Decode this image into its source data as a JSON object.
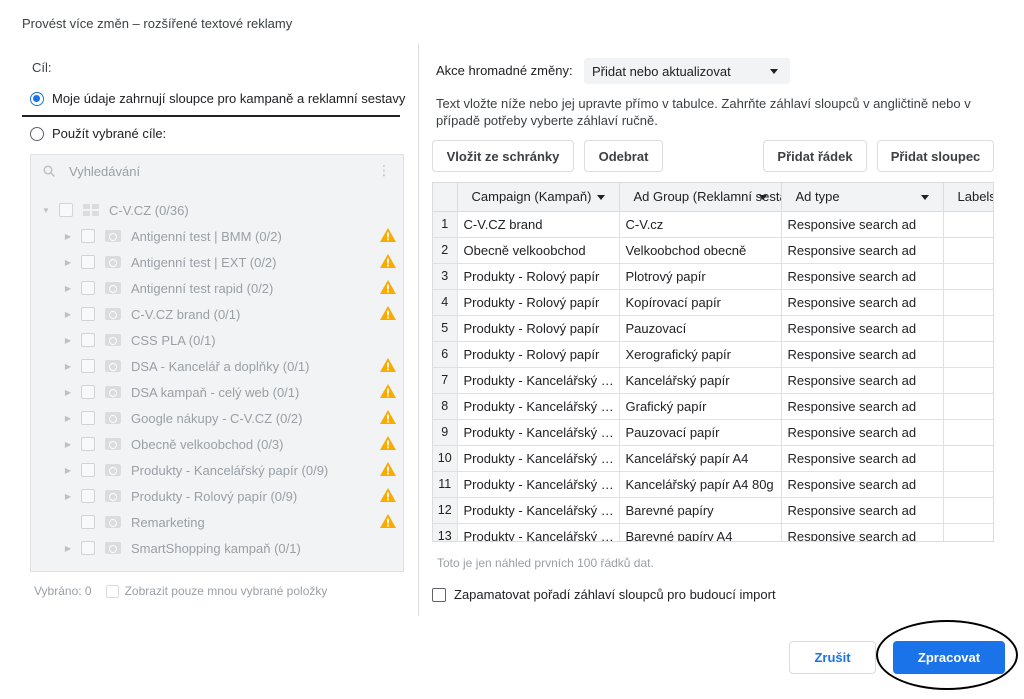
{
  "dialog": {
    "title": "Provést více změn – rozšířené textové reklamy"
  },
  "left": {
    "target_label": "Cíl:",
    "radio_option1": "Moje údaje zahrnují sloupce pro kampaně a reklamní sestavy",
    "radio_option2": "Použít vybrané cíle:",
    "search_placeholder": "Vyhledávání",
    "tree": {
      "root": "C-V.CZ (0/36)",
      "items": [
        {
          "label": "Antigenní test | BMM (0/2)",
          "icon": "search-campaign-icon",
          "warning": true,
          "expandable": true
        },
        {
          "label": "Antigenní test | EXT (0/2)",
          "icon": "search-campaign-icon",
          "warning": true,
          "expandable": true
        },
        {
          "label": "Antigenní test rapid (0/2)",
          "icon": "search-campaign-icon",
          "warning": true,
          "expandable": true
        },
        {
          "label": "C-V.CZ brand (0/1)",
          "icon": "search-campaign-icon",
          "warning": true,
          "expandable": true
        },
        {
          "label": "CSS PLA (0/1)",
          "icon": "shopping-tag-icon",
          "warning": false,
          "expandable": true
        },
        {
          "label": "DSA - Kancelář a doplňky (0/1)",
          "icon": "search-campaign-icon",
          "warning": true,
          "expandable": true
        },
        {
          "label": "DSA kampaň - celý web (0/1)",
          "icon": "search-campaign-icon",
          "warning": true,
          "expandable": true
        },
        {
          "label": "Google nákupy - C-V.CZ (0/2)",
          "icon": "shopping-tag-icon",
          "warning": true,
          "expandable": true
        },
        {
          "label": "Obecně velkoobchod (0/3)",
          "icon": "search-campaign-icon",
          "warning": true,
          "expandable": true
        },
        {
          "label": "Produkty - Kancelářský papír (0/9)",
          "icon": "search-campaign-icon",
          "warning": true,
          "expandable": true
        },
        {
          "label": "Produkty - Rolový papír (0/9)",
          "icon": "search-campaign-icon",
          "warning": true,
          "expandable": true
        },
        {
          "label": "Remarketing",
          "icon": "display-campaign-icon",
          "warning": true,
          "expandable": false
        },
        {
          "label": "SmartShopping kampaň (0/1)",
          "icon": "shopping-tag-icon",
          "warning": false,
          "expandable": true
        }
      ]
    },
    "selected_count": "Vybráno: 0",
    "show_only_selected": "Zobrazit pouze mnou vybrané položky"
  },
  "right": {
    "bulk_action_label": "Akce hromadné změny:",
    "bulk_action_value": "Přidat nebo aktualizovat",
    "help_text": "Text vložte níže nebo jej upravte přímo v tabulce. Zahrňte záhlaví sloupců v angličtině nebo v případě potřeby vyberte záhlaví ručně.",
    "buttons": {
      "paste": "Vložit ze schránky",
      "remove": "Odebrat",
      "add_row": "Přidat řádek",
      "add_column": "Přidat sloupec"
    },
    "table": {
      "headers": [
        "Campaign (Kampaň)",
        "Ad Group (Reklamní sestava)",
        "Ad type",
        "Labels"
      ],
      "rows": [
        [
          "1",
          "C-V.CZ brand",
          "C-V.cz",
          "Responsive search ad"
        ],
        [
          "2",
          "Obecně velkoobchod",
          "Velkoobchod obecně",
          "Responsive search ad"
        ],
        [
          "3",
          "Produkty - Rolový papír",
          "Plotrový papír",
          "Responsive search ad"
        ],
        [
          "4",
          "Produkty - Rolový papír",
          "Kopírovací papír",
          "Responsive search ad"
        ],
        [
          "5",
          "Produkty - Rolový papír",
          "Pauzovací",
          "Responsive search ad"
        ],
        [
          "6",
          "Produkty - Rolový papír",
          "Xerografický papír",
          "Responsive search ad"
        ],
        [
          "7",
          "Produkty - Kancelářský papír",
          "Kancelářský papír",
          "Responsive search ad"
        ],
        [
          "8",
          "Produkty - Kancelářský papír",
          "Grafický papír",
          "Responsive search ad"
        ],
        [
          "9",
          "Produkty - Kancelářský papír",
          "Pauzovací papír",
          "Responsive search ad"
        ],
        [
          "10",
          "Produkty - Kancelářský papír",
          "Kancelářský papír A4",
          "Responsive search ad"
        ],
        [
          "11",
          "Produkty - Kancelářský papír",
          "Kancelářský papír A4 80g",
          "Responsive search ad"
        ],
        [
          "12",
          "Produkty - Kancelářský papír",
          "Barevné papíry",
          "Responsive search ad"
        ],
        [
          "13",
          "Produkty - Kancelářský papír",
          "Barevné papíry A4",
          "Responsive search ad"
        ]
      ]
    },
    "preview_note": "Toto je jen náhled prvních 100 řádků dat.",
    "remember_headers": "Zapamatovat pořadí záhlaví sloupců pro budoucí import"
  },
  "footer": {
    "cancel": "Zrušit",
    "process": "Zpracovat"
  },
  "colors": {
    "primary": "#1a73e8",
    "warning": "#f9ab00",
    "disabled_bg": "#f1f3f4"
  }
}
